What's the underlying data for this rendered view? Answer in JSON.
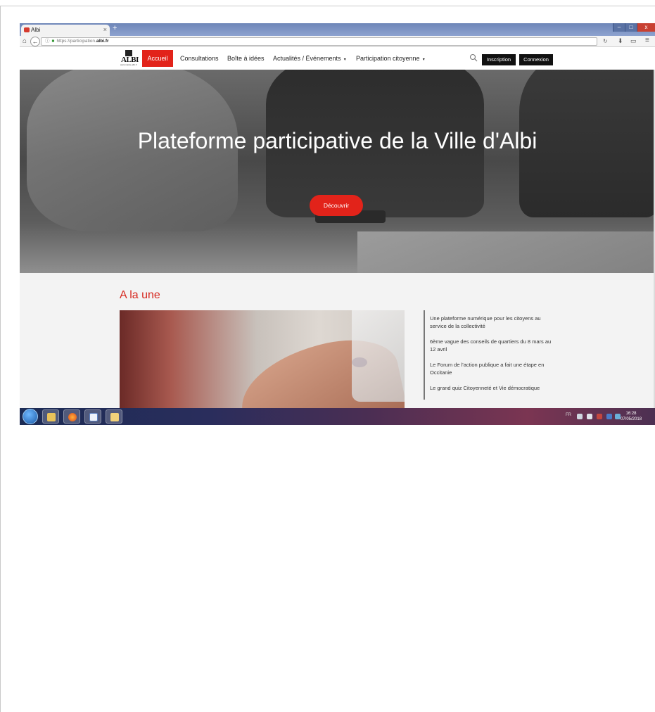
{
  "browser": {
    "tab_title": "Albi",
    "tab_close": "×",
    "new_tab": "+",
    "url_prefix": "https://participation.",
    "url_domain": "albi.fr",
    "window_controls": [
      "–",
      "□",
      "x"
    ],
    "icons": [
      "home-icon",
      "back-arrow-icon",
      "info-icon",
      "lock-icon",
      "reload-icon",
      "download-icon",
      "library-icon",
      "menu-icon"
    ]
  },
  "site": {
    "logo": {
      "name": "ALBI",
      "prefix": "VILLE D'",
      "sub": "www.mairie-albi.fr"
    },
    "nav": {
      "accueil": "Accueil",
      "consultations": "Consultations",
      "boite": "Boîte à idées",
      "actualites": "Actualités / Événements",
      "participation": "Participation citoyenne"
    },
    "inscription": "Inscription",
    "connexion": "Connexion",
    "accent": "#e2231a"
  },
  "hero": {
    "title": "Plateforme participative de la Ville d'Albi",
    "button": "Découvrir"
  },
  "une": {
    "title": "A la une",
    "items": [
      "Une plateforme numérique pour les citoyens au service de la collectivité",
      "6ème vague des conseils de quartiers du 8 mars au 12 avril",
      "Le Forum de l'action publique a fait une étape en Occitanie",
      "Le grand quiz Citoyenneté et Vie démocratique"
    ]
  },
  "taskbar": {
    "lang": "FR",
    "time": "16:28",
    "date": "07/05/2018",
    "apps": [
      "windows-start-icon",
      "explorer-icon",
      "firefox-icon",
      "document-icon",
      "folder-icon"
    ]
  }
}
